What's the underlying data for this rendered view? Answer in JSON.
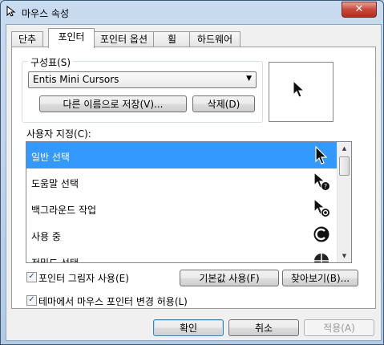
{
  "window": {
    "title": "마우스 속성",
    "close_glyph": "✕"
  },
  "tabs": [
    {
      "label": "단추",
      "active": false
    },
    {
      "label": "포인터",
      "active": true
    },
    {
      "label": "포인터 옵션",
      "active": false
    },
    {
      "label": "휠",
      "active": false
    },
    {
      "label": "하드웨어",
      "active": false
    }
  ],
  "scheme": {
    "group_label": "구성표(S)",
    "selected": "Entis Mini Cursors",
    "save_as_label": "다른 이름으로 저장(V)...",
    "delete_label": "삭제(D)"
  },
  "customize": {
    "label": "사용자 지정(C):",
    "items": [
      {
        "label": "일반 선택",
        "icon": "arrow-cursor-icon",
        "selected": true
      },
      {
        "label": "도움말 선택",
        "icon": "help-cursor-icon",
        "selected": false
      },
      {
        "label": "백그라운드 작업",
        "icon": "working-in-background-cursor-icon",
        "selected": false
      },
      {
        "label": "사용 중",
        "icon": "busy-cursor-icon",
        "selected": false
      },
      {
        "label": "정밀도 선택",
        "icon": "precision-cursor-icon",
        "selected": false
      }
    ]
  },
  "options": {
    "shadow_label": "포인터 그림자 사용(E)",
    "shadow_checked": true,
    "theme_label": "테마에서 마우스 포인터 변경 허용(L)",
    "theme_checked": true,
    "check_glyph": "✓",
    "default_label": "기본값 사용(F)",
    "browse_label": "찾아보기(B)..."
  },
  "footer": {
    "ok_label": "확인",
    "cancel_label": "취소",
    "apply_label": "적용(A)"
  },
  "colors": {
    "selection": "#3399ff",
    "close_button": "#c9473a"
  }
}
